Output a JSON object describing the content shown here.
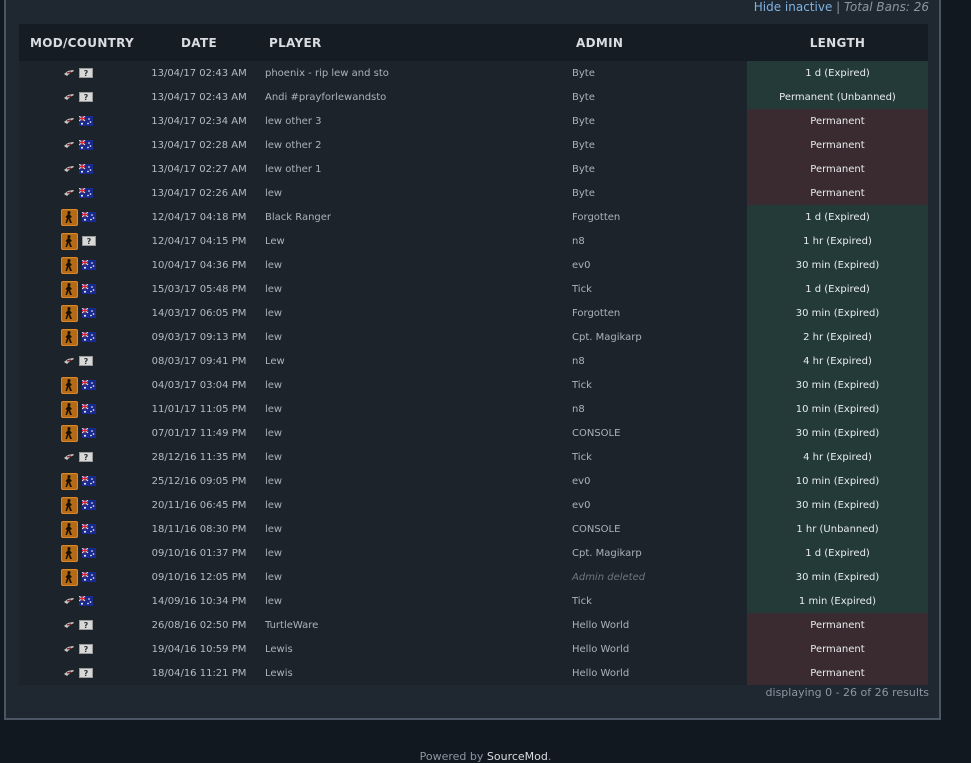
{
  "toolbar": {
    "hide_inactive": "Hide inactive",
    "separator": "|",
    "total_bans": "Total Bans: 26"
  },
  "table": {
    "headers": {
      "mod": "MOD/COUNTRY",
      "date": "DATE",
      "player": "PLAYER",
      "admin": "ADMIN",
      "length": "LENGTH"
    },
    "rows": [
      {
        "mod": "hl2",
        "flag": "unknown",
        "date": "13/04/17 02:43 AM",
        "player": "phoenix - rip lew and sto",
        "admin": "Byte",
        "admin_deleted": false,
        "length": "1 d (Expired)",
        "status": "ok"
      },
      {
        "mod": "hl2",
        "flag": "unknown",
        "date": "13/04/17 02:43 AM",
        "player": "Andi #prayforlewandsto",
        "admin": "Byte",
        "admin_deleted": false,
        "length": "Permanent (Unbanned)",
        "status": "ok"
      },
      {
        "mod": "hl2",
        "flag": "au",
        "date": "13/04/17 02:34 AM",
        "player": "lew other 3",
        "admin": "Byte",
        "admin_deleted": false,
        "length": "Permanent",
        "status": "perm"
      },
      {
        "mod": "hl2",
        "flag": "au",
        "date": "13/04/17 02:28 AM",
        "player": "lew other 2",
        "admin": "Byte",
        "admin_deleted": false,
        "length": "Permanent",
        "status": "perm"
      },
      {
        "mod": "hl2",
        "flag": "au",
        "date": "13/04/17 02:27 AM",
        "player": "lew other 1",
        "admin": "Byte",
        "admin_deleted": false,
        "length": "Permanent",
        "status": "perm"
      },
      {
        "mod": "hl2",
        "flag": "au",
        "date": "13/04/17 02:26 AM",
        "player": "lew",
        "admin": "Byte",
        "admin_deleted": false,
        "length": "Permanent",
        "status": "perm"
      },
      {
        "mod": "csgo",
        "flag": "au",
        "date": "12/04/17 04:18 PM",
        "player": "Black Ranger",
        "admin": "Forgotten",
        "admin_deleted": false,
        "length": "1 d (Expired)",
        "status": "ok"
      },
      {
        "mod": "csgo",
        "flag": "unknown",
        "date": "12/04/17 04:15 PM",
        "player": "Lew",
        "admin": "n8",
        "admin_deleted": false,
        "length": "1 hr (Expired)",
        "status": "ok"
      },
      {
        "mod": "csgo",
        "flag": "au",
        "date": "10/04/17 04:36 PM",
        "player": "lew",
        "admin": "ev0",
        "admin_deleted": false,
        "length": "30 min (Expired)",
        "status": "ok"
      },
      {
        "mod": "csgo",
        "flag": "au",
        "date": "15/03/17 05:48 PM",
        "player": "lew",
        "admin": "Tick",
        "admin_deleted": false,
        "length": "1 d (Expired)",
        "status": "ok"
      },
      {
        "mod": "csgo",
        "flag": "au",
        "date": "14/03/17 06:05 PM",
        "player": "lew",
        "admin": "Forgotten",
        "admin_deleted": false,
        "length": "30 min (Expired)",
        "status": "ok"
      },
      {
        "mod": "csgo",
        "flag": "au",
        "date": "09/03/17 09:13 PM",
        "player": "lew",
        "admin": "Cpt. Magikarp",
        "admin_deleted": false,
        "length": "2 hr (Expired)",
        "status": "ok"
      },
      {
        "mod": "hl2",
        "flag": "unknown",
        "date": "08/03/17 09:41 PM",
        "player": "Lew",
        "admin": "n8",
        "admin_deleted": false,
        "length": "4 hr (Expired)",
        "status": "ok"
      },
      {
        "mod": "csgo",
        "flag": "au",
        "date": "04/03/17 03:04 PM",
        "player": "lew",
        "admin": "Tick",
        "admin_deleted": false,
        "length": "30 min (Expired)",
        "status": "ok"
      },
      {
        "mod": "csgo",
        "flag": "au",
        "date": "11/01/17 11:05 PM",
        "player": "lew",
        "admin": "n8",
        "admin_deleted": false,
        "length": "10 min (Expired)",
        "status": "ok"
      },
      {
        "mod": "csgo",
        "flag": "au",
        "date": "07/01/17 11:49 PM",
        "player": "lew",
        "admin": "CONSOLE",
        "admin_deleted": false,
        "length": "30 min (Expired)",
        "status": "ok"
      },
      {
        "mod": "hl2",
        "flag": "unknown",
        "date": "28/12/16 11:35 PM",
        "player": "lew",
        "admin": "Tick",
        "admin_deleted": false,
        "length": "4 hr (Expired)",
        "status": "ok"
      },
      {
        "mod": "csgo",
        "flag": "au",
        "date": "25/12/16 09:05 PM",
        "player": "lew",
        "admin": "ev0",
        "admin_deleted": false,
        "length": "10 min (Expired)",
        "status": "ok"
      },
      {
        "mod": "csgo",
        "flag": "au",
        "date": "20/11/16 06:45 PM",
        "player": "lew",
        "admin": "ev0",
        "admin_deleted": false,
        "length": "30 min (Expired)",
        "status": "ok"
      },
      {
        "mod": "csgo",
        "flag": "au",
        "date": "18/11/16 08:30 PM",
        "player": "lew",
        "admin": "CONSOLE",
        "admin_deleted": false,
        "length": "1 hr (Unbanned)",
        "status": "ok"
      },
      {
        "mod": "csgo",
        "flag": "au",
        "date": "09/10/16 01:37 PM",
        "player": "lew",
        "admin": "Cpt. Magikarp",
        "admin_deleted": false,
        "length": "1 d (Expired)",
        "status": "ok"
      },
      {
        "mod": "csgo",
        "flag": "au",
        "date": "09/10/16 12:05 PM",
        "player": "lew",
        "admin": "Admin deleted",
        "admin_deleted": true,
        "length": "30 min (Expired)",
        "status": "ok"
      },
      {
        "mod": "hl2",
        "flag": "au",
        "date": "14/09/16 10:34 PM",
        "player": "lew",
        "admin": "Tick",
        "admin_deleted": false,
        "length": "1 min (Expired)",
        "status": "ok"
      },
      {
        "mod": "hl2",
        "flag": "unknown",
        "date": "26/08/16 02:50 PM",
        "player": "TurtleWare",
        "admin": "Hello World",
        "admin_deleted": false,
        "length": "Permanent",
        "status": "perm"
      },
      {
        "mod": "hl2",
        "flag": "unknown",
        "date": "19/04/16 10:59 PM",
        "player": "Lewis",
        "admin": "Hello World",
        "admin_deleted": false,
        "length": "Permanent",
        "status": "perm"
      },
      {
        "mod": "hl2",
        "flag": "unknown",
        "date": "18/04/16 11:21 PM",
        "player": "Lewis",
        "admin": "Hello World",
        "admin_deleted": false,
        "length": "Permanent",
        "status": "perm"
      }
    ]
  },
  "pagination": {
    "summary": "displaying 0 - 26 of 26 results"
  },
  "footer": {
    "powered_prefix": "Powered by ",
    "powered_link": "SourceMod",
    "powered_suffix": "."
  },
  "colors": {
    "background": "#121820",
    "panel": "#1f2730",
    "row_ok": "#233a39",
    "row_perm": "#3a2b30",
    "link": "#7fb2e0"
  }
}
